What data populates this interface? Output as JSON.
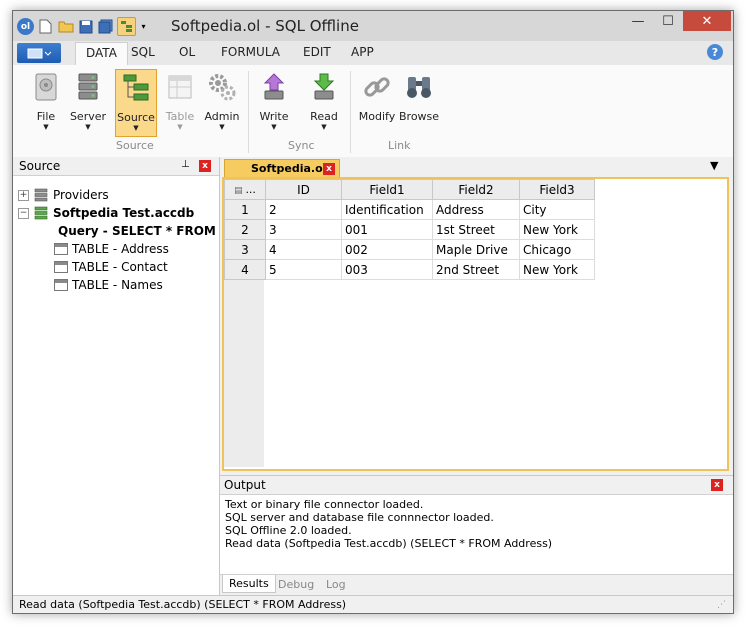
{
  "window": {
    "title": "Softpedia.ol - SQL Offline",
    "controls": {
      "minimize": "—",
      "maximize": "☐",
      "close": "✕"
    }
  },
  "ribbon": {
    "tabs": [
      "DATA",
      "SQL",
      "OL",
      "FORMULA",
      "EDIT",
      "APP"
    ],
    "active_tab": "DATA",
    "help": "?",
    "buttons": {
      "file": "File",
      "server": "Server",
      "source": "Source",
      "table": "Table",
      "admin": "Admin",
      "write": "Write",
      "read": "Read",
      "modify": "Modify",
      "browse": "Browse"
    },
    "groups": {
      "source": "Source",
      "sync": "Sync",
      "link": "Link"
    }
  },
  "source_pane": {
    "title": "Source",
    "pin": "⊥",
    "close": "x",
    "tree": {
      "providers": "Providers",
      "database": "Softpedia Test.accdb",
      "query": "Query - SELECT * FROM Address",
      "tables": [
        "TABLE - Address",
        "TABLE - Contact",
        "TABLE - Names"
      ]
    }
  },
  "document": {
    "tab_label": "Softpedia.ol",
    "tab_close": "x",
    "grid": {
      "corner": "...",
      "columns": [
        "ID",
        "Field1",
        "Field2",
        "Field3"
      ],
      "rows": [
        {
          "n": "1",
          "cells": [
            "2",
            "Identification",
            "Address",
            "City"
          ]
        },
        {
          "n": "2",
          "cells": [
            "3",
            "001",
            "1st Street",
            "New York"
          ]
        },
        {
          "n": "3",
          "cells": [
            "4",
            "002",
            "Maple Drive",
            "Chicago"
          ]
        },
        {
          "n": "4",
          "cells": [
            "5",
            "003",
            "2nd Street",
            "New York"
          ]
        }
      ]
    }
  },
  "output_pane": {
    "title": "Output",
    "close": "x",
    "lines": [
      "Text or binary file connector loaded.",
      "SQL server and database file connnector loaded.",
      "SQL Offline 2.0 loaded.",
      "Read data (Softpedia Test.accdb) (SELECT * FROM Address)"
    ],
    "tabs": [
      "Results",
      "Debug",
      "Log"
    ]
  },
  "status_bar": {
    "text": "Read data (Softpedia Test.accdb) (SELECT * FROM Address)"
  }
}
